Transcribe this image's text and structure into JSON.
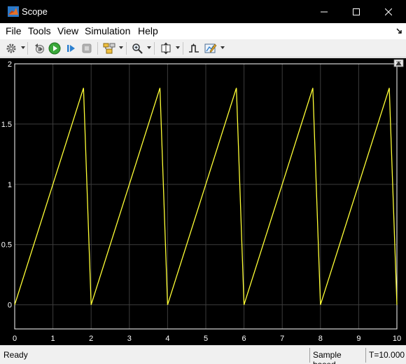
{
  "window": {
    "title": "Scope"
  },
  "menu": [
    {
      "label": "File"
    },
    {
      "label": "Tools"
    },
    {
      "label": "View"
    },
    {
      "label": "Simulation"
    },
    {
      "label": "Help"
    }
  ],
  "toolbar": {
    "icons": [
      "gear-icon",
      "restore-icon",
      "run-icon",
      "step-forward-icon",
      "stop-icon",
      "highlight-icon",
      "zoom-icon",
      "autoscale-icon",
      "trigger-icon",
      "cursor-icon"
    ]
  },
  "colors": {
    "plot_bg": "#000000",
    "trace": "#ffff35",
    "grid": "#3c3c3c",
    "axis_text": "#ffffff"
  },
  "chart_data": {
    "type": "line",
    "title": "",
    "xlabel": "",
    "ylabel": "",
    "xlim": [
      0,
      10
    ],
    "ylim": [
      -0.2,
      2
    ],
    "xticks": [
      "0",
      "1",
      "2",
      "3",
      "4",
      "5",
      "6",
      "7",
      "8",
      "9",
      "10"
    ],
    "yticks": [
      "0",
      "0.5",
      "1",
      "1.5",
      "2"
    ],
    "grid": true,
    "series": [
      {
        "x": [
          0,
          1.8,
          2,
          3.8,
          4,
          5.8,
          6,
          7.8,
          8,
          9.8,
          10
        ],
        "y": [
          0,
          1.8,
          0,
          1.8,
          0,
          1.8,
          0,
          1.8,
          0,
          1.8,
          0
        ]
      }
    ]
  },
  "status": {
    "ready": "Ready",
    "mode": "Sample based",
    "time": "T=10.000"
  }
}
